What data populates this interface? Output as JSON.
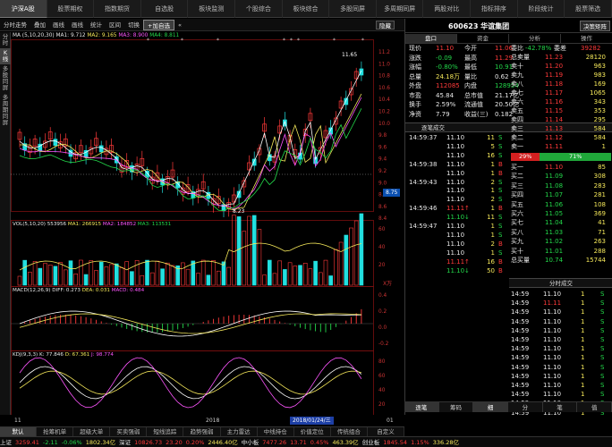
{
  "top_nav": [
    "沪深A股",
    "股票期权",
    "指数期货",
    "自选股",
    "板块监测",
    "个股综合",
    "板块综合",
    "多股同屏",
    "多周期同屏",
    "两股对比",
    "指标排序",
    "阶段统计",
    "股票筛选"
  ],
  "toolbar": {
    "items": [
      "分时走势",
      "叠加",
      "画线",
      "画线",
      "统计",
      "区间",
      "切换",
      "+加自选",
      "«"
    ],
    "right": "隐藏"
  },
  "left_strip": [
    "分时",
    "K线",
    "多股同屏",
    "多周期同屏"
  ],
  "ma_line": {
    "label": "MA (5,10,20,30)",
    "ma1": "MA1: 9.712",
    "ma2": "MA2: 9.165",
    "ma3": "MA3: 8.900",
    "ma4": "MA4: 8.811"
  },
  "kline": {
    "high_label": "11.65",
    "low_label": "8.23",
    "price_tag": "8.75",
    "y_ticks": [
      "11.2",
      "11.0",
      "10.8",
      "10.6",
      "10.4",
      "10.2",
      "10.0",
      "9.8",
      "9.6",
      "9.4",
      "9.2",
      "9.0",
      "8.8",
      "8.6",
      "8.4"
    ]
  },
  "vol_panel": {
    "label": "VOL(5,10,20)",
    "v1": "553956",
    "ma1": "MA1: 266915",
    "ma2": "MA2: 184852",
    "ma3": "MA3: 113531",
    "y_ticks": [
      "60",
      "40",
      "20"
    ],
    "unit": "X万"
  },
  "macd_panel": {
    "label": "MACD(12,26,9)",
    "diff": "DIFF: 0.273",
    "dea": "DEA: 0.031",
    "macd": "MACD: 0.484",
    "y_ticks": [
      "0.4",
      "0.2",
      "0.0",
      "-0.2"
    ]
  },
  "kdj_panel": {
    "label": "KDJ(9,3,3)",
    "k": "K: 77.846",
    "d": "D: 67.361",
    "j": "J: 98.774",
    "y_ticks": [
      "80",
      "60",
      "40",
      "20"
    ]
  },
  "x_axis": {
    "left": "11",
    "mid": "2018",
    "date_box": "2018/01/24/三",
    "right": "01"
  },
  "bottom_tabs": [
    "默认",
    "抢筹机单",
    "超级大单",
    "买卖强弱",
    "短线追踪",
    "趋势强弱",
    "主力雷达",
    "中线持仓",
    "价值定位",
    "传统组合",
    "自定义"
  ],
  "right_panel": {
    "stock": "600623 华谊集团",
    "action_button": "决策矩阵",
    "tabs": [
      "盘口",
      "资金",
      "分析",
      "操作"
    ],
    "quote_rows": [
      [
        [
          "现价",
          "white"
        ],
        [
          "11.10",
          "red"
        ],
        [
          "今开",
          "white"
        ],
        [
          "11.06",
          "red"
        ]
      ],
      [
        [
          "涨跌",
          "white"
        ],
        [
          "-0.09",
          "green"
        ],
        [
          "最高",
          "white"
        ],
        [
          "11.29",
          "red"
        ]
      ],
      [
        [
          "涨幅",
          "white"
        ],
        [
          "-0.80%",
          "green"
        ],
        [
          "最低",
          "white"
        ],
        [
          "10.91",
          "green"
        ]
      ],
      [
        [
          "总量",
          "white"
        ],
        [
          "24.18万",
          "yellow"
        ],
        [
          "量比",
          "white"
        ],
        [
          "0.62",
          "white"
        ]
      ],
      [
        [
          "外盘",
          "white"
        ],
        [
          "112085",
          "red"
        ],
        [
          "内盘",
          "white"
        ],
        [
          "128954",
          "green"
        ]
      ],
      [
        [
          "市盈",
          "white"
        ],
        [
          "45.84",
          "white"
        ],
        [
          "总市值",
          "white"
        ],
        [
          "21.17亿",
          "white"
        ]
      ],
      [
        [
          "换手",
          "white"
        ],
        [
          "2.59%",
          "white"
        ],
        [
          "流通值",
          "white"
        ],
        [
          "20.50亿",
          "white"
        ]
      ],
      [
        [
          "净资",
          "white"
        ],
        [
          "7.79",
          "white"
        ],
        [
          "收益(三)",
          "white"
        ],
        [
          "0.182",
          "white"
        ]
      ]
    ],
    "tick_header": "逐笔成交",
    "ticks": [
      [
        "14:59:37",
        "11.10",
        "11",
        "S"
      ],
      [
        "",
        "11.10",
        "5",
        "S"
      ],
      [
        "",
        "11.10",
        "16",
        "S"
      ],
      [
        "14:59:38",
        "11.10",
        "1",
        "B"
      ],
      [
        "",
        "11.10",
        "1",
        "B"
      ],
      [
        "14:59:43",
        "11.10",
        "2",
        "S"
      ],
      [
        "",
        "11.10",
        "1",
        "S"
      ],
      [
        "",
        "11.10",
        "2",
        "S"
      ],
      [
        "14:59:46",
        "11.11↑",
        "1",
        "B"
      ],
      [
        "",
        "11.10↓",
        "11",
        "S"
      ],
      [
        "14:59:47",
        "11.10",
        "1",
        "S"
      ],
      [
        "",
        "11.10",
        "1",
        "S"
      ],
      [
        "",
        "11.10",
        "2",
        "B"
      ],
      [
        "",
        "11.10",
        "1",
        "S"
      ],
      [
        "",
        "11.11↑",
        "16",
        "B"
      ],
      [
        "",
        "11.10↓",
        "50",
        "B"
      ]
    ],
    "order_book": {
      "header": [
        "委比",
        "-42.78%",
        "委差",
        "39282"
      ],
      "sells": [
        [
          "总卖量",
          "11.23",
          "28120"
        ],
        [
          "卖十",
          "11.20",
          "963"
        ],
        [
          "卖九",
          "11.19",
          "983"
        ],
        [
          "卖八",
          "11.18",
          "169"
        ],
        [
          "卖七",
          "11.17",
          "1065"
        ],
        [
          "卖六",
          "11.16",
          "343"
        ],
        [
          "卖五",
          "11.15",
          "353"
        ],
        [
          "卖四",
          "11.14",
          "295"
        ],
        [
          "卖三",
          "11.13",
          "584"
        ],
        [
          "卖二",
          "11.12",
          "584"
        ],
        [
          "卖一",
          "11.11",
          "1"
        ]
      ],
      "ratio": [
        "29%",
        "71%"
      ],
      "buys": [
        [
          "买一",
          "11.10",
          "85"
        ],
        [
          "买二",
          "11.09",
          "308"
        ],
        [
          "买三",
          "11.08",
          "283"
        ],
        [
          "买四",
          "11.07",
          "281"
        ],
        [
          "买五",
          "11.06",
          "108"
        ],
        [
          "买六",
          "11.05",
          "369"
        ],
        [
          "买七",
          "11.04",
          "41"
        ],
        [
          "买八",
          "11.03",
          "71"
        ],
        [
          "买九",
          "11.02",
          "263"
        ],
        [
          "买十",
          "11.01",
          "288"
        ],
        [
          "总买量",
          "10.74",
          "15744"
        ]
      ]
    },
    "time_header": "分时成交",
    "time_rows": [
      [
        "14:59",
        "11.10",
        "1",
        "S"
      ],
      [
        "14:59",
        "11.11",
        "1",
        "S"
      ],
      [
        "14:59",
        "11.10",
        "1",
        "S"
      ],
      [
        "14:59",
        "11.10",
        "1",
        "S"
      ],
      [
        "14:59",
        "11.10",
        "1",
        "S"
      ],
      [
        "14:59",
        "11.10",
        "1",
        "S"
      ],
      [
        "14:59",
        "11.10",
        "1",
        "S"
      ],
      [
        "14:59",
        "11.10",
        "1",
        "S"
      ],
      [
        "14:59",
        "11.10",
        "1",
        "S"
      ],
      [
        "14:59",
        "11.10",
        "1",
        "S"
      ],
      [
        "14:59",
        "11.10",
        "1",
        "S"
      ],
      [
        "14:59",
        "11.10",
        "1",
        "S"
      ],
      [
        "14:59",
        "11.10",
        "1",
        "S"
      ],
      [
        "14:59",
        "11.10",
        "1",
        "S"
      ]
    ],
    "bottom_tabs_left": [
      "逐笔",
      "筹码"
    ],
    "bottom_tabs_right": [
      "细",
      "分",
      "笔",
      "值"
    ]
  },
  "status_bar": [
    [
      "上证",
      "white"
    ],
    [
      "3259.41",
      "red"
    ],
    [
      "-2.11",
      "green"
    ],
    [
      "-0.06%",
      "green"
    ],
    [
      "1802.34亿",
      "yellow"
    ],
    [
      "深证",
      "white"
    ],
    [
      "10826.73",
      "red"
    ],
    [
      "23.20",
      "red"
    ],
    [
      "0.20%",
      "red"
    ],
    [
      "2446.40亿",
      "yellow"
    ],
    [
      "中小板",
      "white"
    ],
    [
      "7477.26",
      "red"
    ],
    [
      "13.71",
      "red"
    ],
    [
      "0.45%",
      "red"
    ],
    [
      "463.39亿",
      "yellow"
    ],
    [
      "创业板",
      "white"
    ],
    [
      "1845.54",
      "red"
    ],
    [
      "1.15%",
      "red"
    ],
    [
      "336.28亿",
      "yellow"
    ]
  ],
  "colors": {
    "up": "#ff3a3a",
    "down": "#23d84a",
    "accent": "#33d3e8"
  }
}
